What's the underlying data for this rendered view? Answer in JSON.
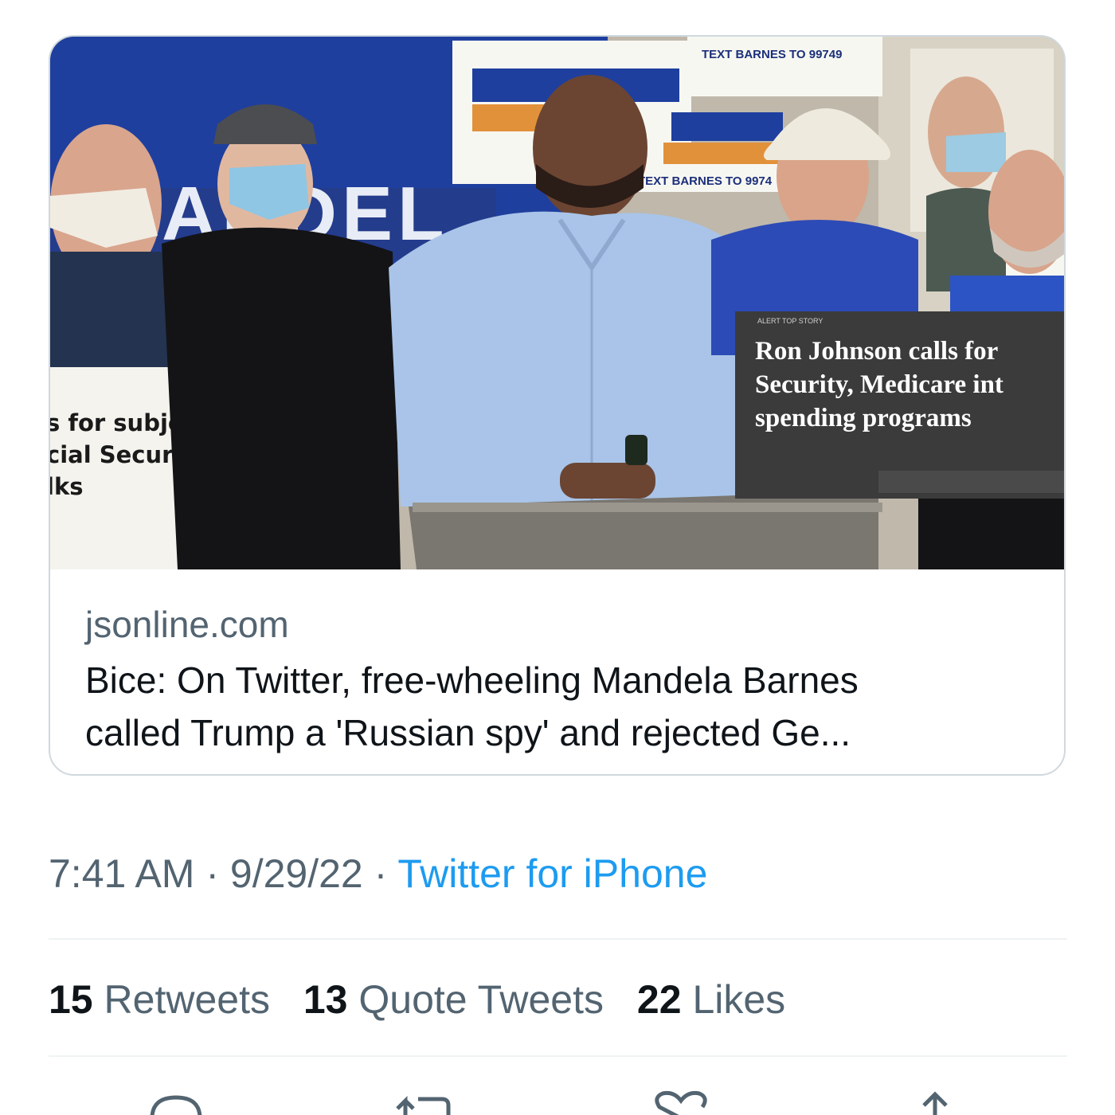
{
  "link_card": {
    "image_alt": "Mandela Barnes speaking at a lectern surrounded by supporters holding signs",
    "image_sign_text": {
      "text_barnes_top": "TEXT BARNES TO 99749",
      "text_barnes_mid": "TEXT BARNES TO 9974",
      "left_sign_line1": "s for subjecting",
      "left_sign_line2": "cial Security to",
      "left_sign_line3": "lks",
      "news_sign_line1": "Ron Johnson calls for",
      "news_sign_line2": "Security, Medicare int",
      "news_sign_line3": "spending programs"
    },
    "domain": "jsonline.com",
    "title_line1": "Bice: On Twitter, free-wheeling Mandela Barnes",
    "title_line2": "called Trump a 'Russian spy' and rejected Ge..."
  },
  "meta": {
    "time": "7:41 AM",
    "separator": "·",
    "date": "9/29/22",
    "source": "Twitter for iPhone"
  },
  "stats": [
    {
      "count": "15",
      "label": "Retweets"
    },
    {
      "count": "13",
      "label": "Quote Tweets"
    },
    {
      "count": "22",
      "label": "Likes"
    }
  ],
  "actions": [
    "reply-icon",
    "retweet-icon",
    "like-icon",
    "share-icon"
  ],
  "colors": {
    "link_blue": "#1d9bf0",
    "secondary_text": "#536471",
    "border": "#cfd9de",
    "backdrop_blue": "#1f3f9e",
    "shirt_blue": "#a9c4e8"
  }
}
